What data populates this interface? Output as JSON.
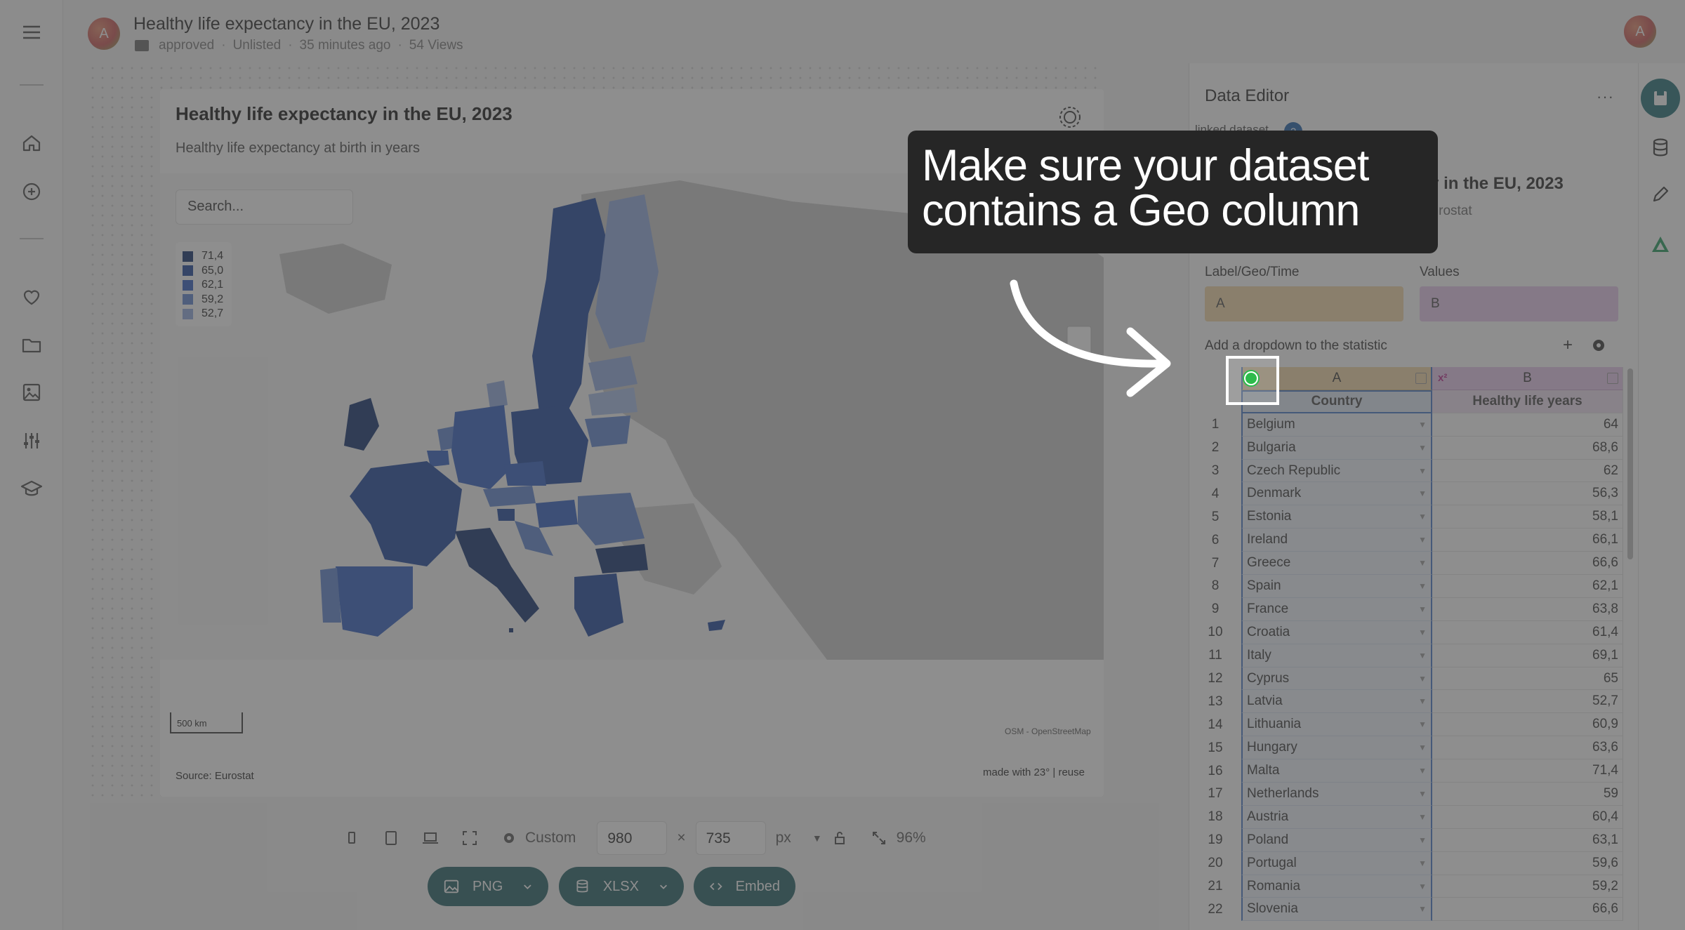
{
  "header": {
    "title": "Healthy life expectancy in the EU, 2023",
    "status": "approved",
    "visibility": "Unlisted",
    "updated": "35 minutes ago",
    "views": "54 Views",
    "avatar_initial": "A"
  },
  "sidebar": {
    "icons": [
      "menu-icon",
      "home-icon",
      "plus-circle-icon",
      "heart-icon",
      "folder-icon",
      "image-icon",
      "sliders-icon",
      "graduation-cap-icon"
    ]
  },
  "chart": {
    "title": "Healthy life expectancy in the EU, 2023",
    "subtitle": "Healthy life expectancy at birth in years",
    "search_placeholder": "Search...",
    "legend": [
      {
        "label": "71,4",
        "color": "#0c2a6b"
      },
      {
        "label": "65,0",
        "color": "#163f9a"
      },
      {
        "label": "62,1",
        "color": "#2a59bf"
      },
      {
        "label": "59,2",
        "color": "#5a82d0"
      },
      {
        "label": "52,7",
        "color": "#8ea9df"
      }
    ],
    "scale_label": "500 km",
    "attribution": "OSM - OpenStreetMap",
    "source": "Source: Eurostat",
    "made_with": "made with 23° | reuse"
  },
  "size_bar": {
    "preset": "Custom",
    "width": "980",
    "x_sign": "×",
    "height": "735",
    "unit": "px",
    "zoom": "96%"
  },
  "export": {
    "png": "PNG",
    "xlsx": "XLSX",
    "embed": "Embed"
  },
  "editor": {
    "title": "Data Editor",
    "more": "···",
    "linked_label": "linked dataset",
    "linked_badge": "?",
    "dataset_title": "Healthy life expectancy in the EU, 2023",
    "dataset_meta": "scheduled updates · Quelle: Eurostat",
    "label_geo_time": "Label/Geo/Time",
    "values_label": "Values",
    "col_a_select": "A",
    "col_b_select": "B",
    "dropdown_label": "Add a dropdown to the statistic",
    "plus": "+",
    "col_a": "A",
    "col_b": "B",
    "col_a_header": "Country",
    "col_b_header": "Healthy life years",
    "rows": [
      {
        "n": "1",
        "country": "Belgium",
        "value": "64"
      },
      {
        "n": "2",
        "country": "Bulgaria",
        "value": "68,6"
      },
      {
        "n": "3",
        "country": "Czech Republic",
        "value": "62"
      },
      {
        "n": "4",
        "country": "Denmark",
        "value": "56,3"
      },
      {
        "n": "5",
        "country": "Estonia",
        "value": "58,1"
      },
      {
        "n": "6",
        "country": "Ireland",
        "value": "66,1"
      },
      {
        "n": "7",
        "country": "Greece",
        "value": "66,6"
      },
      {
        "n": "8",
        "country": "Spain",
        "value": "62,1"
      },
      {
        "n": "9",
        "country": "France",
        "value": "63,8"
      },
      {
        "n": "10",
        "country": "Croatia",
        "value": "61,4"
      },
      {
        "n": "11",
        "country": "Italy",
        "value": "69,1"
      },
      {
        "n": "12",
        "country": "Cyprus",
        "value": "65"
      },
      {
        "n": "13",
        "country": "Latvia",
        "value": "52,7"
      },
      {
        "n": "14",
        "country": "Lithuania",
        "value": "60,9"
      },
      {
        "n": "15",
        "country": "Hungary",
        "value": "63,6"
      },
      {
        "n": "16",
        "country": "Malta",
        "value": "71,4"
      },
      {
        "n": "17",
        "country": "Netherlands",
        "value": "59"
      },
      {
        "n": "18",
        "country": "Austria",
        "value": "60,4"
      },
      {
        "n": "19",
        "country": "Poland",
        "value": "63,1"
      },
      {
        "n": "20",
        "country": "Portugal",
        "value": "59,6"
      },
      {
        "n": "21",
        "country": "Romania",
        "value": "59,2"
      },
      {
        "n": "22",
        "country": "Slovenia",
        "value": "66,6"
      }
    ]
  },
  "tooltip": {
    "line1": "Make sure your dataset",
    "line2": "contains a Geo column"
  },
  "colors": {
    "accent": "#1f5c63",
    "col_a_tint": "#f5d8a5",
    "col_b_tint": "#e8c8ec",
    "selection": "#3f73c9"
  }
}
